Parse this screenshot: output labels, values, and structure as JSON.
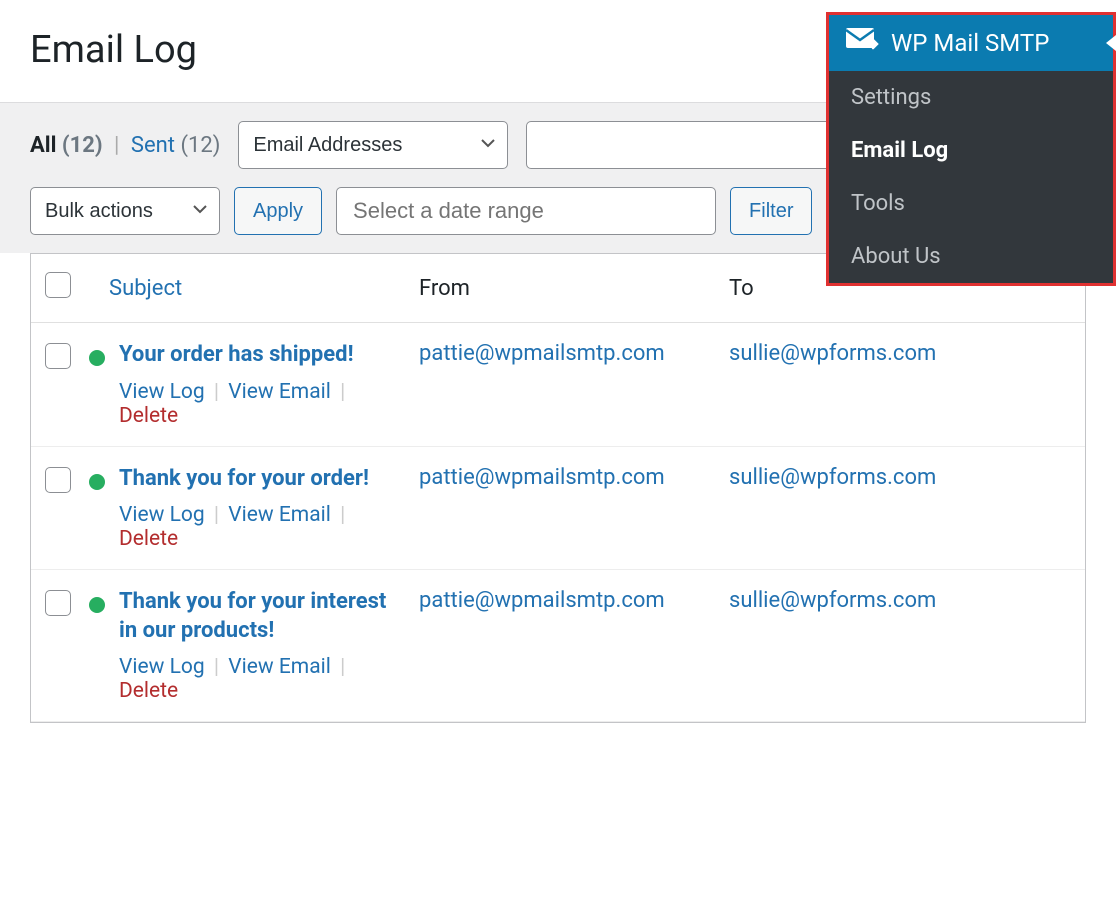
{
  "page": {
    "title": "Email Log"
  },
  "status": {
    "all_label": "All",
    "all_count": "(12)",
    "sent_label": "Sent",
    "sent_count": "(12)"
  },
  "filters": {
    "address_dropdown": "Email Addresses",
    "search_value": "",
    "bulk_dropdown": "Bulk actions",
    "apply_btn": "Apply",
    "date_placeholder": "Select a date range",
    "filter_btn": "Filter"
  },
  "table": {
    "head_subject": "Subject",
    "head_from": "From",
    "head_to": "To",
    "rows": [
      {
        "subject": "Your order has shipped!",
        "from": "pattie@wpmailsmtp.com",
        "to": "sullie@wpforms.com"
      },
      {
        "subject": "Thank you for your order!",
        "from": "pattie@wpmailsmtp.com",
        "to": "sullie@wpforms.com"
      },
      {
        "subject": "Thank you for your interest in our products!",
        "from": "pattie@wpmailsmtp.com",
        "to": "sullie@wpforms.com"
      }
    ],
    "actions": {
      "view_log": "View Log",
      "view_email": "View Email",
      "delete": "Delete"
    }
  },
  "flyout": {
    "title": "WP Mail SMTP",
    "items": [
      {
        "label": "Settings",
        "active": false
      },
      {
        "label": "Email Log",
        "active": true
      },
      {
        "label": "Tools",
        "active": false
      },
      {
        "label": "About Us",
        "active": false
      }
    ]
  }
}
